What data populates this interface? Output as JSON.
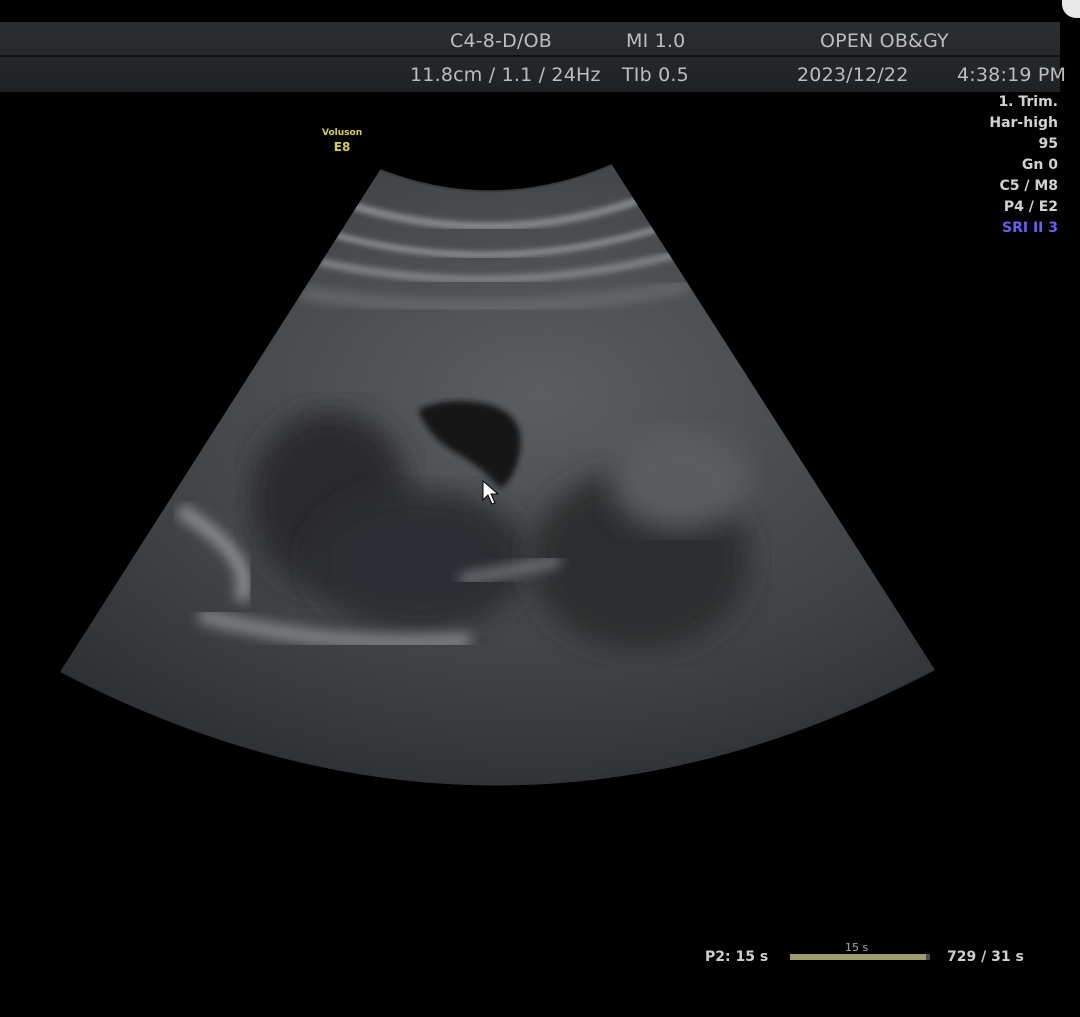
{
  "header": {
    "probe": "C4-8-D/OB",
    "mi": "MI  1.0",
    "institution": "OPEN OB&GY",
    "params": "11.8cm / 1.1 / 24Hz",
    "tib": "TIb  0.5",
    "date": "2023/12/22",
    "time": "4:38:19 PM"
  },
  "brand": {
    "line1": "Voluson",
    "line2": "E8"
  },
  "side_panel": {
    "trim": "1. Trim.",
    "harmonic": "Har-high",
    "value": "95",
    "gain": "Gn   0",
    "cm": "C5 / M8",
    "pe": "P4 / E2",
    "sri": "SRI II 3"
  },
  "footer": {
    "p2": "P2:   15 s",
    "cine_label": "15 s",
    "cine_fill_fraction": 0.97,
    "frames": "729 / 31 s"
  },
  "icons": {
    "cursor": "mouse-pointer-icon"
  },
  "colors": {
    "brand": "#d9d42a",
    "sri": "#6c5cff",
    "background": "#000000"
  }
}
